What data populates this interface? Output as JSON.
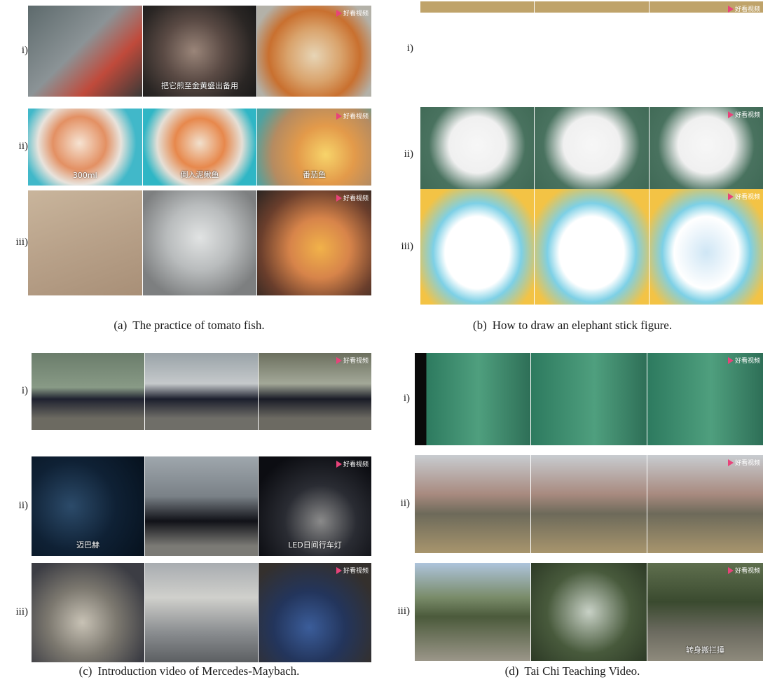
{
  "panels": [
    {
      "caption": "The practice of tomato fish.",
      "tag": "(a)",
      "rows": [
        {
          "label": "i)",
          "frames": [
            {
              "bg": "linear-gradient(135deg,#5d6a6c 0%,#8b9396 45%,#c04a3b 70%,#3a3a38 100%)",
              "text": "",
              "logo": false
            },
            {
              "bg": "radial-gradient(circle at 45% 50%,#9a8579 0%,#5a4a44 40%,#2a2624 75%,#1a1a1a 100%)",
              "text": "把它煎至金黄盛出备用",
              "logo": false
            },
            {
              "bg": "radial-gradient(circle at 50% 55%,#e7d5b6 0%,#d9a36c 35%,#c9702f 60%,#b3b1a8 85%)",
              "text": "",
              "logo": true
            }
          ]
        },
        {
          "label": "ii)",
          "frames": [
            {
              "bg": "radial-gradient(circle at 45% 45%,#f6e3d2 0%,#e39063 35%,#e8e3dc 55%,#41b8c9 75%)",
              "text": "300ml",
              "logo": false
            },
            {
              "bg": "radial-gradient(circle at 50% 45%,#f1e0cd 0%,#e7884c 35%,#e5dfd6 60%,#2fb6c5 80%)",
              "text": "倒入泥鳅鱼",
              "logo": false
            },
            {
              "bg": "radial-gradient(circle at 60% 60%,#f7d46a 0%,#e39a4a 35%,#b58b61 65%,#4ba3a3 90%)",
              "text": "番茄鱼",
              "logo": true
            }
          ]
        },
        {
          "label": "iii)",
          "frames": [
            {
              "bg": "linear-gradient(160deg,#c9b59c 0%,#b8a189 50%,#a88f77 100%)",
              "text": "",
              "logo": false
            },
            {
              "bg": "radial-gradient(circle at 50% 45%,#e1e3e3 0%,#b9bcbd 40%,#7d7f80 80%)",
              "text": "",
              "logo": false
            },
            {
              "bg": "radial-gradient(circle at 55% 55%,#f1b24a 0%,#d7844a 35%,#6a3e2c 70%,#2b2522 100%)",
              "text": "",
              "logo": true
            }
          ]
        }
      ]
    },
    {
      "caption": "How to draw an elephant stick figure.",
      "tag": "(b)",
      "rows": [
        {
          "label": "i)",
          "frames": [
            {
              "bg": "linear-gradient(180deg,#bfa36a 0%,#bfa36a 12%,#ffffff 12%,#ffffff 100%)",
              "text": "",
              "logo": false
            },
            {
              "bg": "linear-gradient(180deg,#bfa36a 0%,#bfa36a 12%,#ffffff 12%,#ffffff 100%)",
              "text": "",
              "logo": false
            },
            {
              "bg": "linear-gradient(180deg,#bfa36a 0%,#bfa36a 12%,#ffffff 12%,#ffffff 100%)",
              "text": "",
              "logo": true
            }
          ]
        },
        {
          "label": "ii)",
          "frames": [
            {
              "bg": "radial-gradient(circle at 50% 40%,#f7f7f7 0%,#f0f0f0 35%,#49725f 60%,#3c6652 100%)",
              "text": "",
              "logo": false
            },
            {
              "bg": "radial-gradient(circle at 50% 40%,#f7f7f7 0%,#f0f0f0 35%,#49725f 60%,#3c6652 100%)",
              "text": "",
              "logo": false
            },
            {
              "bg": "radial-gradient(circle at 50% 40%,#f7f7f7 0%,#f0f0f0 35%,#49725f 60%,#3c6652 100%)",
              "text": "",
              "logo": true
            }
          ]
        },
        {
          "label": "iii)",
          "frames": [
            {
              "bg": "radial-gradient(ellipse at 50% 55%,#ffffff 0%,#ffffff 40%,#7dd0e6 55%,#f3c345 80%)",
              "text": "",
              "logo": false
            },
            {
              "bg": "radial-gradient(ellipse at 50% 55%,#ffffff 0%,#ffffff 40%,#7dd0e6 55%,#f3c345 80%)",
              "text": "",
              "logo": false
            },
            {
              "bg": "radial-gradient(ellipse at 50% 55%,#cfe6f5 0%,#ffffff 40%,#7dd0e6 55%,#f3c345 80%)",
              "text": "",
              "logo": true
            }
          ]
        }
      ]
    },
    {
      "caption": "Introduction video of Mercedes-Maybach.",
      "tag": "(c)",
      "rows": [
        {
          "label": "i)",
          "frames": [
            {
              "bg": "linear-gradient(180deg,#6b7d6b 0%,#889a86 45%,#1f2230 60%,#6c6a61 85%)",
              "text": "",
              "logo": false
            },
            {
              "bg": "linear-gradient(180deg,#9aa3a8 0%,#c5c9cb 40%,#1c1f2d 60%,#6f6e68 85%)",
              "text": "",
              "logo": false
            },
            {
              "bg": "linear-gradient(180deg,#6b6f5e 0%,#a3a898 40%,#1a1c27 60%,#6c6a62 85%)",
              "text": "",
              "logo": true
            }
          ]
        },
        {
          "label": "ii)",
          "frames": [
            {
              "bg": "radial-gradient(circle at 35% 50%,#2c4b6a 0%,#0f2135 50%,#06111d 100%)",
              "text": "迈巴赫",
              "logo": false
            },
            {
              "bg": "linear-gradient(180deg,#9fa7ad 0%,#7a8187 40%,#111218 65%,#7b7a75 90%)",
              "text": "",
              "logo": false
            },
            {
              "bg": "radial-gradient(circle at 55% 65%,#8a8a8a 0%,#2a2c33 40%,#0c0d12 80%)",
              "text": "LED日间行车灯",
              "logo": true
            }
          ]
        },
        {
          "label": "iii)",
          "frames": [
            {
              "bg": "radial-gradient(circle at 45% 60%,#c8c2b5 0%,#7c786f 40%,#3c3d44 80%)",
              "text": "",
              "logo": false
            },
            {
              "bg": "linear-gradient(180deg,#a8acb0 0%,#d0d0cc 35%,#8a8d90 70%,#5c5f62 100%)",
              "text": "",
              "logo": false
            },
            {
              "bg": "radial-gradient(circle at 45% 65%,#3b5d9a 0%,#23355c 40%,#34302d 80%)",
              "text": "",
              "logo": true
            }
          ]
        }
      ]
    },
    {
      "caption": "Tai Chi Teaching Video.",
      "tag": "(d)",
      "rows": [
        {
          "label": "i)",
          "frames": [
            {
              "bg": "linear-gradient(90deg,#0a0a0a 0%,#0a0a0a 10%,#2d7a5f 10%,#4f9f7e 55%,#2e6f57 100%)",
              "text": "",
              "logo": false
            },
            {
              "bg": "linear-gradient(90deg,#2d7a5f 0%,#4f9f7e 55%,#2e6f57 100%)",
              "text": "",
              "logo": false
            },
            {
              "bg": "linear-gradient(90deg,#2d7a5f 0%,#4f9f7e 55%,#2e6f57 100%)",
              "text": "",
              "logo": true
            }
          ]
        },
        {
          "label": "ii)",
          "frames": [
            {
              "bg": "linear-gradient(180deg,#c8ccd0 0%,#a88a7f 40%,#6d6a5a 60%,#a8956d 100%)",
              "text": "",
              "logo": false
            },
            {
              "bg": "linear-gradient(180deg,#c8ccd0 0%,#a88a7f 40%,#6d6a5a 60%,#a8956d 100%)",
              "text": "",
              "logo": false
            },
            {
              "bg": "linear-gradient(180deg,#c8ccd0 0%,#a88a7f 40%,#6d6a5a 60%,#a8956d 100%)",
              "text": "",
              "logo": true
            }
          ]
        },
        {
          "label": "iii)",
          "frames": [
            {
              "bg": "linear-gradient(180deg,#aec4dc 0%,#7a8c6a 35%,#4b5a3b 55%,#9b9689 100%)",
              "text": "",
              "logo": false
            },
            {
              "bg": "radial-gradient(circle at 50% 50%,#c8d1c6 0%,#485a3c 55%,#2d3a26 100%)",
              "text": "",
              "logo": false
            },
            {
              "bg": "linear-gradient(180deg,#5f6f4e 0%,#3a4a2f 40%,#6b6a5f 70%,#8e8a7c 100%)",
              "text": "转身搬拦捶",
              "logo": true
            }
          ]
        }
      ]
    }
  ],
  "logo_text": "好看视频"
}
